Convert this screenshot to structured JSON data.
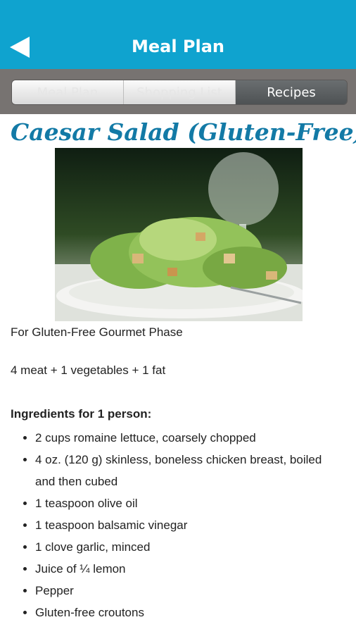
{
  "app": {
    "title": "Meal Plan",
    "back_icon": "back-arrow-icon"
  },
  "tabs": [
    {
      "label": "Meal Plan",
      "active": false
    },
    {
      "label": "Shopping List",
      "active": false
    },
    {
      "label": "Recipes",
      "active": true
    }
  ],
  "recipe": {
    "title": "Caesar Salad (Gluten-Free)",
    "phase": "For Gluten-Free Gourmet Phase",
    "portions": "4 meat + 1 vegetables + 1 fat",
    "ingredients_heading": "Ingredients for 1 person:",
    "ingredients": [
      "2 cups romaine lettuce, coarsely chopped",
      "4 oz. (120 g) skinless, boneless chicken breast, boiled and then cubed",
      "1 teaspoon olive oil",
      "1 teaspoon balsamic vinegar",
      "1 clove garlic, minced",
      "Juice of ¼ lemon",
      "Pepper",
      "Gluten-free croutons"
    ]
  },
  "colors": {
    "header": "#0fa3cf",
    "title_text": "#137aa6",
    "tab_strip": "#777371"
  }
}
